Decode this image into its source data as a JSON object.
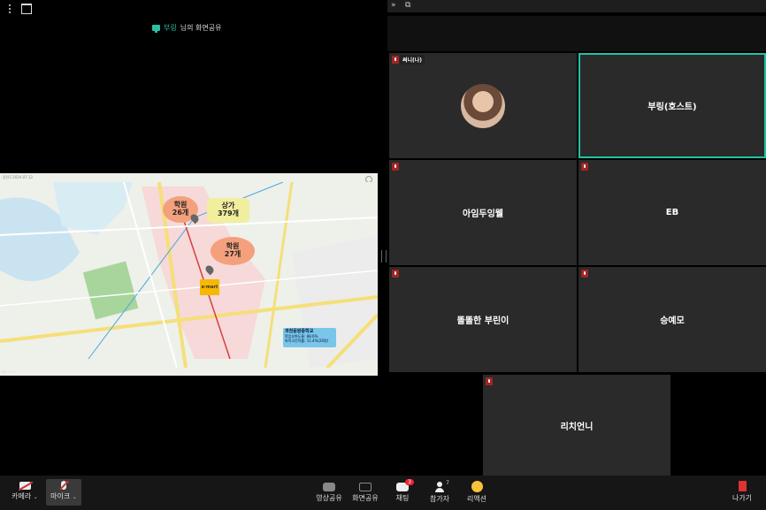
{
  "share_banner": {
    "sharer": "부링",
    "suffix": "님의 화면공유"
  },
  "shared_screen": {
    "header": "동탄2 2024.07.12",
    "labels": {
      "academy_a": [
        "학원",
        "26개"
      ],
      "shops": [
        "상가",
        "379개"
      ],
      "academy_b": [
        "학원",
        "27개"
      ],
      "store": "e·mart",
      "school_name": "과천문원중학교",
      "school_line1": "학업성취도율: 88.6%",
      "school_line2": "특목고진학률: 11.4%(20명)"
    }
  },
  "participants": [
    {
      "name": "써니(나)",
      "has_avatar": true
    },
    {
      "name": "부링(호스트)",
      "active": true
    },
    {
      "name": "아임두잉웰"
    },
    {
      "name": "EB"
    },
    {
      "name": "똘똘한 부린이"
    },
    {
      "name": "승예모"
    },
    {
      "name": "리치언니"
    }
  ],
  "toolbar": {
    "camera": "카메라",
    "mic": "마이크",
    "video_share": "영상공유",
    "screen_share": "화면공유",
    "chat": "채팅",
    "chat_badge": "3",
    "participants": "참가자",
    "participants_count": "7",
    "reaction": "리액션",
    "leave": "나가기"
  },
  "colors": {
    "accent": "#1fc2a5",
    "muted_mic": "#a02525",
    "tile_bg": "#2a2a2a"
  }
}
